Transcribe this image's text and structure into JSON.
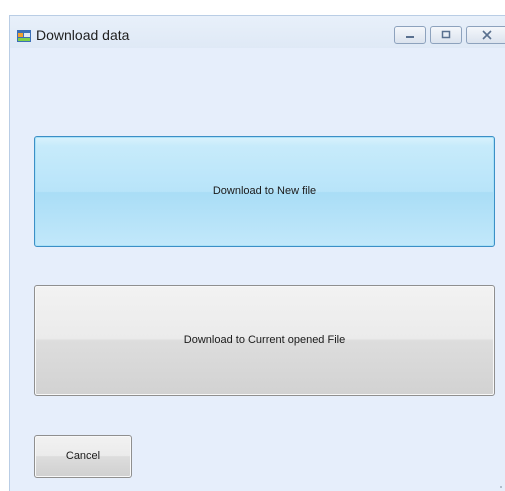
{
  "window": {
    "title": "Download data",
    "icons": {
      "app": "app-window-icon",
      "minimize": "minimize-icon",
      "maximize": "maximize-icon",
      "close": "close-icon"
    }
  },
  "buttons": {
    "new_file": "Download to New file",
    "current_file": "Download to Current opened File",
    "cancel": "Cancel"
  },
  "colors": {
    "accent_button": "#b8e4f9",
    "accent_border": "#3c8fc6",
    "window_bg": "#e6eefb"
  }
}
